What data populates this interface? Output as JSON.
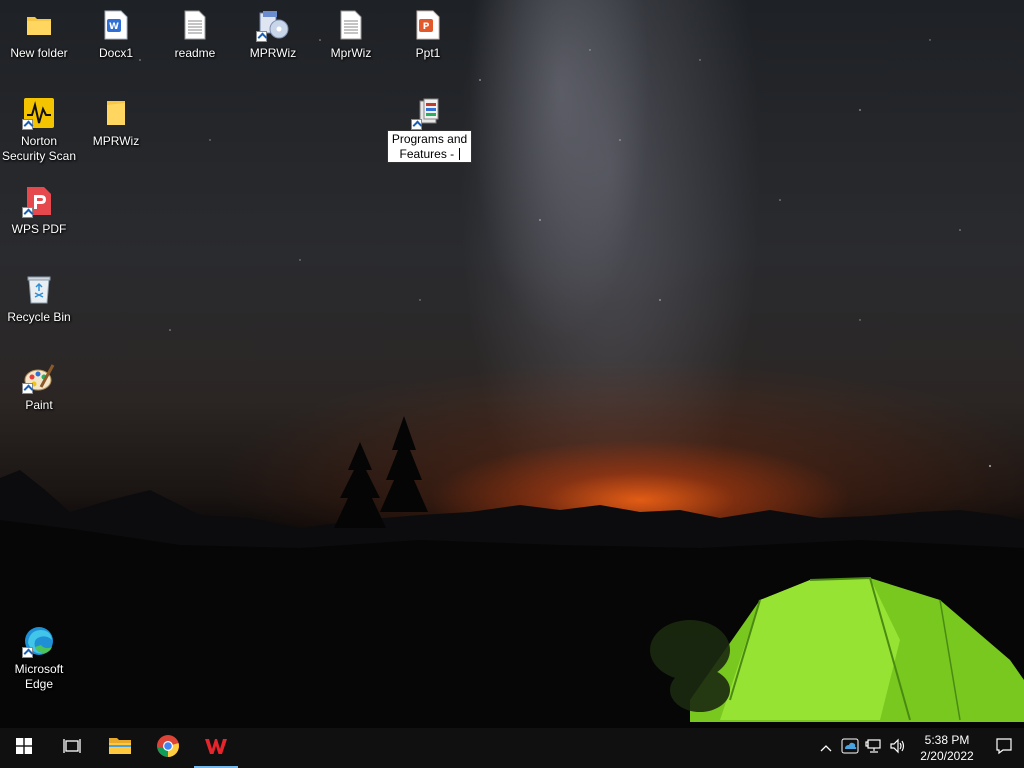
{
  "desktop": {
    "icons": [
      {
        "label": "New folder",
        "icon": "folder-icon"
      },
      {
        "label": "Docx1",
        "icon": "word-doc-icon"
      },
      {
        "label": "readme",
        "icon": "text-file-icon"
      },
      {
        "label": "MPRWiz",
        "icon": "mprwiz-setup-icon"
      },
      {
        "label": "MprWiz",
        "icon": "text-file-icon"
      },
      {
        "label": "Ppt1",
        "icon": "powerpoint-icon"
      },
      {
        "label": "Norton Security Scan",
        "icon": "norton-icon"
      },
      {
        "label": "MPRWiz",
        "icon": "folder-icon"
      },
      {
        "label": "Programs and Features - ",
        "icon": "programs-features-icon",
        "editing": true
      },
      {
        "label": "WPS PDF",
        "icon": "wps-pdf-icon"
      },
      {
        "label": "Recycle Bin",
        "icon": "recycle-bin-icon"
      },
      {
        "label": "Paint",
        "icon": "paint-icon"
      },
      {
        "label": "Microsoft Edge",
        "icon": "edge-icon"
      }
    ]
  },
  "rename": {
    "line1": "Programs and",
    "line2": "Features - "
  },
  "taskbar": {
    "buttons": [
      {
        "name": "start-button",
        "icon": "windows-logo-icon"
      },
      {
        "name": "task-view-button",
        "icon": "task-view-icon"
      },
      {
        "name": "file-explorer-button",
        "icon": "folder-icon"
      },
      {
        "name": "chrome-button",
        "icon": "chrome-icon"
      },
      {
        "name": "wps-office-button",
        "icon": "wps-icon",
        "active": true
      }
    ],
    "tray": {
      "time": "5:38 PM",
      "date": "2/20/2022",
      "icons": [
        "chevron-up-icon",
        "onedrive-icon",
        "network-icon",
        "volume-icon",
        "notification-icon"
      ]
    }
  },
  "colors": {
    "taskbar_bg": "#101010",
    "active_indicator": "#76b9ed",
    "tent_green": "#7ed321"
  }
}
